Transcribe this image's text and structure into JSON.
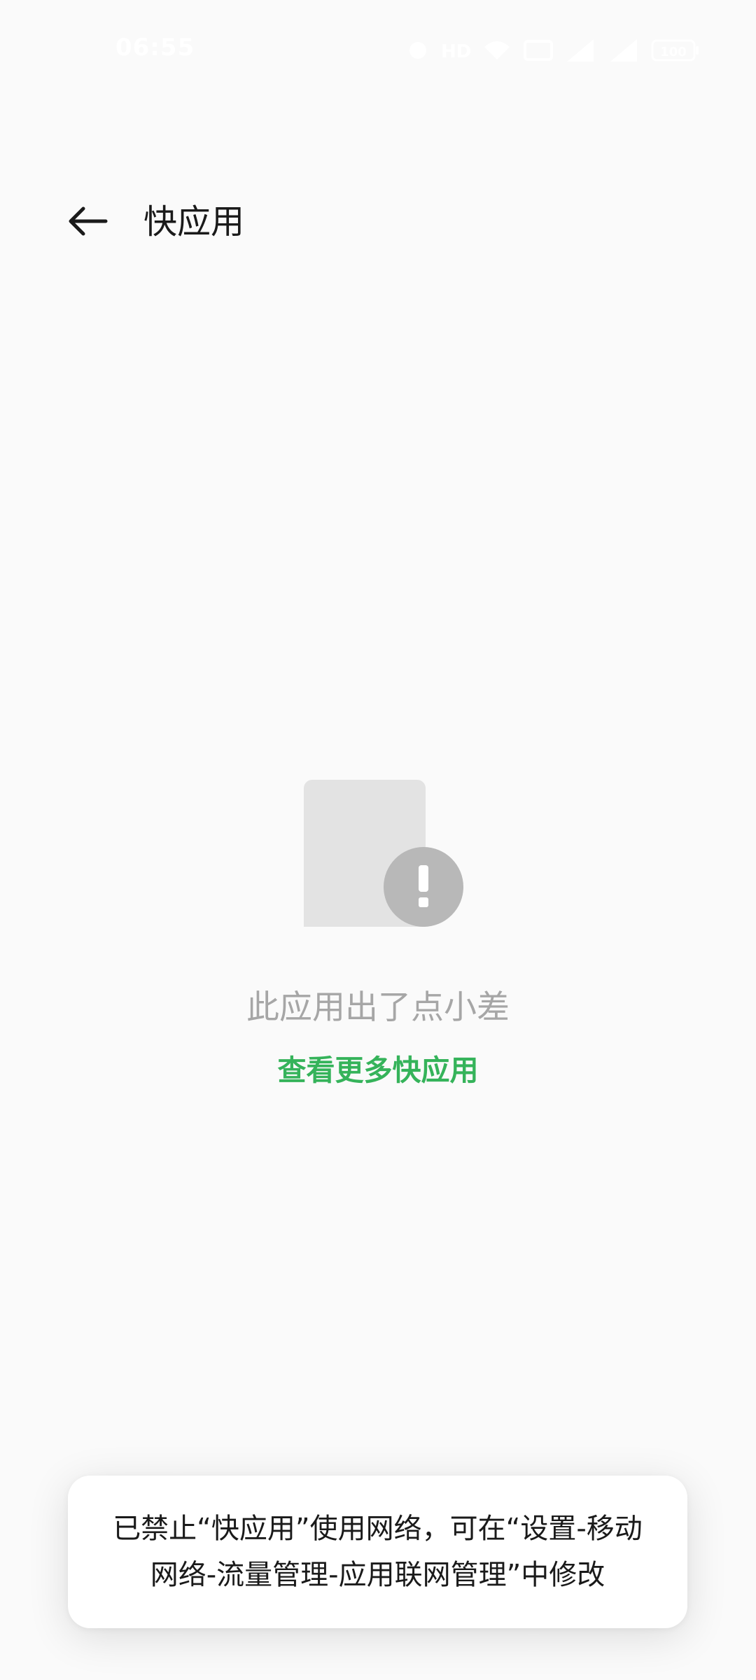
{
  "status_bar": {
    "time": "06:55",
    "battery": "100",
    "icons": [
      "alarm-icon",
      "hd-icon",
      "wifi-icon",
      "nfc-icon",
      "signal-icon",
      "signal-icon",
      "battery-icon"
    ]
  },
  "header": {
    "back_icon": "back-arrow-icon",
    "title": "快应用"
  },
  "error": {
    "illustration_icon": "document-alert-icon",
    "message": "此应用出了点小差",
    "link_label": "查看更多快应用"
  },
  "toast": {
    "line1": "已禁止“快应用”使用网络，可在“设置-移动",
    "line2": "网络-流量管理-应用联网管理”中修改"
  },
  "colors": {
    "background": "#fafafa",
    "link": "#35b35a",
    "muted_text": "#a6a6a6",
    "title_text": "#1a1a1a"
  }
}
